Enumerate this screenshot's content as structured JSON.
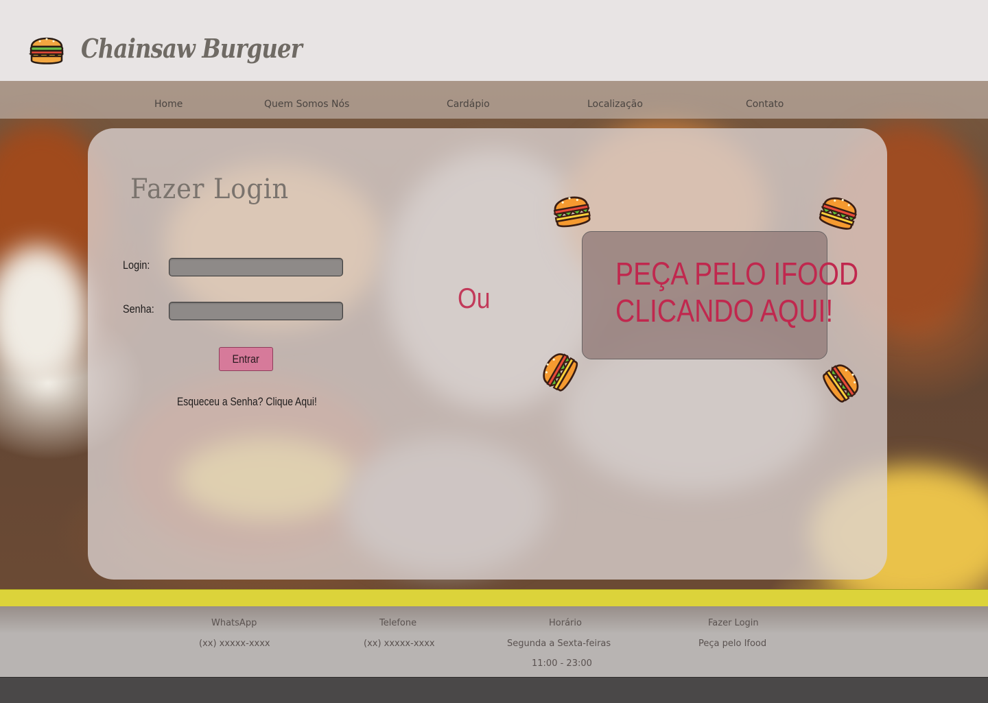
{
  "header": {
    "brand": "Chainsaw Burguer",
    "logo_icon": "burger-icon"
  },
  "nav": {
    "items": [
      {
        "label": "Home"
      },
      {
        "label": "Quem Somos Nós"
      },
      {
        "label": "Cardápio"
      },
      {
        "label": "Localização"
      },
      {
        "label": "Contato"
      }
    ]
  },
  "login": {
    "title": "Fazer Login",
    "login_label": "Login:",
    "login_value": "",
    "password_label": "Senha:",
    "password_value": "",
    "submit_label": "Entrar",
    "forgot_text": "Esqueceu a Senha? Clique Aqui!"
  },
  "separator": "Ou",
  "ifood": {
    "line1": "PEÇA PELO IFOOD",
    "line2": "CLICANDO AQUI!"
  },
  "footer": {
    "columns": [
      {
        "title": "WhatsApp",
        "lines": [
          "(xx) xxxxx-xxxx"
        ]
      },
      {
        "title": "Telefone",
        "lines": [
          "(xx) xxxxx-xxxx"
        ]
      },
      {
        "title": "Horário",
        "lines": [
          "Segunda a Sexta-feiras",
          "11:00 - 23:00"
        ]
      },
      {
        "title": "Fazer Login",
        "lines": [
          "Peça pelo Ifood"
        ]
      }
    ]
  },
  "colors": {
    "accent": "#c0284e",
    "button": "#d67a9a",
    "band": "#dcd33a",
    "header_bg": "#e8e4e4",
    "bottom_bar": "#4a4848"
  }
}
